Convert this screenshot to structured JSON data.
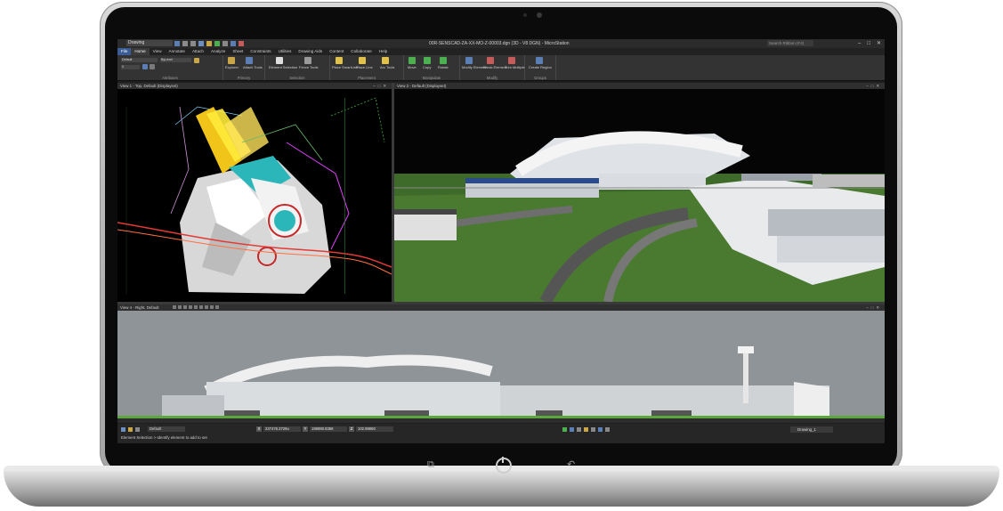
{
  "window": {
    "workspace": "Drawing",
    "title": "00R-SENSCAD-ZA-XX-MO-Z-00003.dgn (3D - V8 DGN) - MicroStation",
    "search_placeholder": "Search Ribbon (F4)",
    "controls": [
      "–",
      "□",
      "✕"
    ]
  },
  "ribbon_tabs": [
    "File",
    "Home",
    "View",
    "Annotate",
    "Attach",
    "Analyze",
    "Sheet",
    "Constraints",
    "Utilities",
    "Drawing Aids",
    "Content",
    "Collaborate",
    "Help"
  ],
  "active_tab": "Home",
  "ribbon_groups": {
    "attributes": {
      "label": "Attributes",
      "level": "Default",
      "line_weight": "ByLevel",
      "color": "0"
    },
    "primary": {
      "label": "Primary",
      "buttons": [
        "Explorer",
        "Attach Tools"
      ]
    },
    "selection": {
      "label": "Selection",
      "buttons": [
        "Element Selection",
        "Fence Tools"
      ]
    },
    "placement": {
      "label": "Placement",
      "buttons": [
        "Place SmartLine",
        "Place Line",
        "Arc Tools"
      ]
    },
    "manipulate": {
      "label": "Manipulate",
      "buttons": [
        "Move",
        "Copy",
        "Rotate"
      ]
    },
    "modify": {
      "label": "Modify",
      "buttons": [
        "Modify Element",
        "Break Element",
        "Trim Multiple"
      ]
    },
    "groups": {
      "label": "Groups",
      "buttons": [
        "Create Region"
      ]
    }
  },
  "views": {
    "v1": {
      "title": "View 1 - Top, Default (Displayset)"
    },
    "v2": {
      "title": "View 2 - Default (Displayset)"
    },
    "v4": {
      "title": "View 4 - Right, Default"
    }
  },
  "status": {
    "level": "Default",
    "x": "237476.3729u",
    "y": "196980.8356",
    "z": "102.98650",
    "model": "Drawing_1",
    "message": "Element Selection > Identify element to add to set"
  },
  "colors": {
    "app_bg": "#1e1e1e",
    "accent": "#3a5d95",
    "grass": "#3f6b2a",
    "sky_right_view": "#8f9499"
  }
}
